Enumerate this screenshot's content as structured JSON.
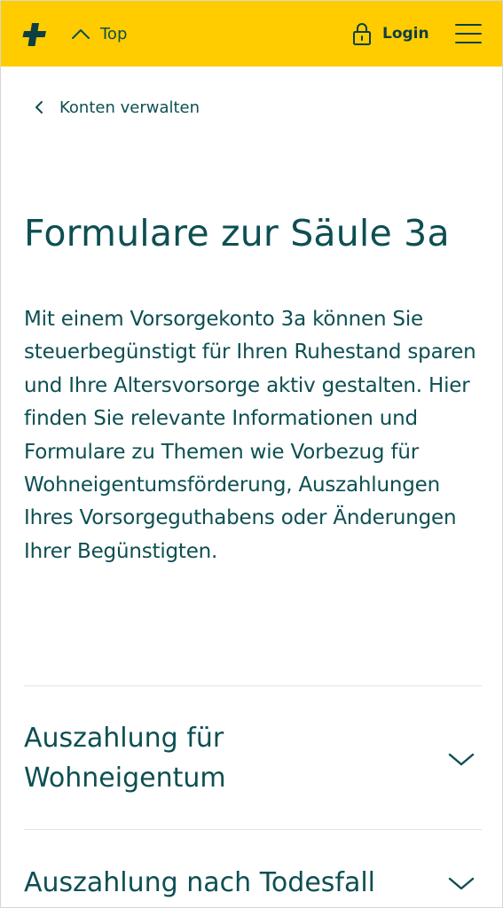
{
  "header": {
    "logo_icon": "swiss-cross-logo",
    "top_label": "Top",
    "login_label": "Login",
    "brand_color": "#ffcc00",
    "text_color": "#0d4f52"
  },
  "breadcrumb": {
    "back_label": "Konten verwalten"
  },
  "page": {
    "title": "Formulare zur Säule 3a",
    "intro": "Mit einem Vorsorgekonto 3a können Sie steuerbegünstigt für Ihren Ruhestand sparen und Ihre Altersvorsorge aktiv gestalten. Hier finden Sie relevante Informationen und Formulare zu Themen wie Vorbezug für Wohneigentumsförderung, Auszahlungen Ihres Vorsorgeguthabens oder Änderungen Ihrer Begünstigten."
  },
  "accordion": {
    "items": [
      {
        "title": "Auszahlung für Wohneigentum",
        "icon": "chevron-down-icon"
      },
      {
        "title": "Auszahlung nach Todesfall",
        "icon": "chevron-down-icon"
      }
    ]
  }
}
